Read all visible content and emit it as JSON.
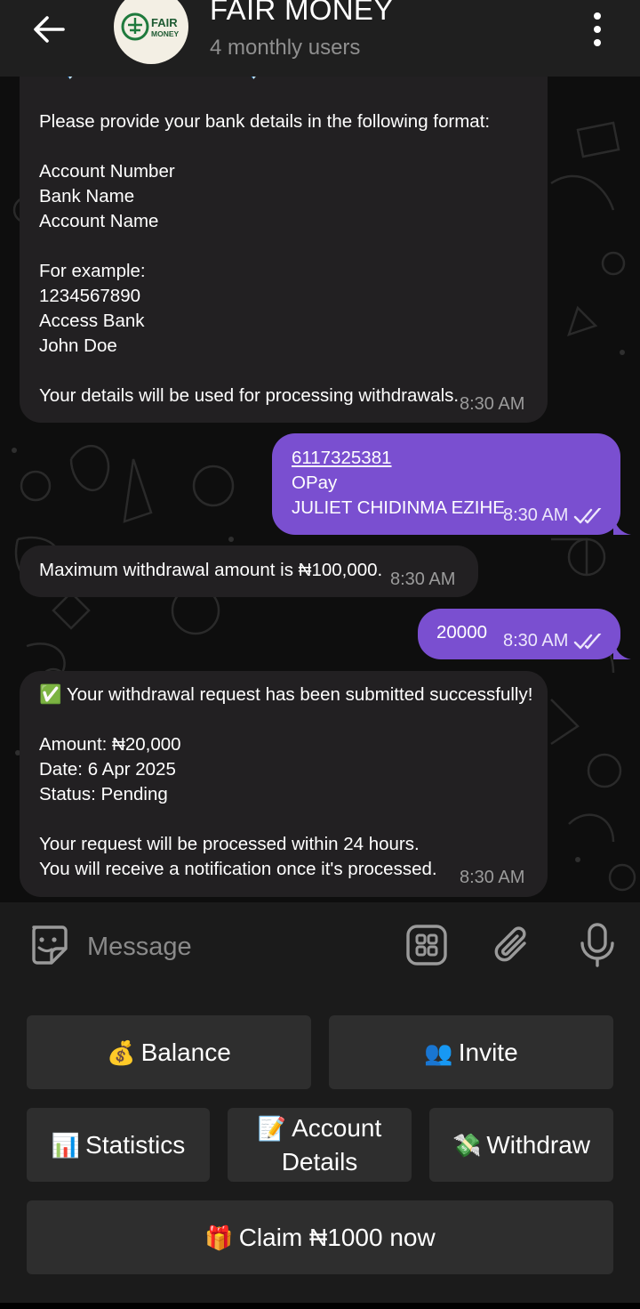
{
  "header": {
    "title": "FAIR MONEY",
    "subtitle": "4 monthly users",
    "logo_text_1": "FAIR",
    "logo_text_2": "MONEY"
  },
  "messages": [
    {
      "direction": "incoming",
      "partial_heading": "💎 Enter Bank Details 💎",
      "text": "Please provide your bank details in the following format:\n\nAccount Number\nBank Name\nAccount Name\n\nFor example:\n1234567890\nAccess Bank\nJohn Doe\n\nYour details will be used for processing withdrawals.",
      "time": "8:30 AM"
    },
    {
      "direction": "outgoing",
      "account_number": "6117325381",
      "text": "OPay\nJULIET CHIDINMA EZIHE",
      "time": "8:30 AM",
      "status": "read"
    },
    {
      "direction": "incoming",
      "text": "Maximum withdrawal amount is ₦100,000.",
      "time": "8:30 AM"
    },
    {
      "direction": "outgoing",
      "text": "20000",
      "time": "8:30 AM",
      "status": "read"
    },
    {
      "direction": "incoming",
      "text": "✅ Your withdrawal request has been submitted successfully!\n\nAmount: ₦20,000\nDate: 6 Apr 2025\nStatus: Pending\n\nYour request will be processed within 24 hours.\nYou will receive a notification once it's processed.",
      "time": "8:30 AM"
    }
  ],
  "input": {
    "placeholder": "Message"
  },
  "keyboard": {
    "balance": {
      "emoji": "💰",
      "label": "Balance"
    },
    "invite": {
      "emoji": "👥",
      "label": "Invite"
    },
    "statistics": {
      "emoji": "📊",
      "label": "Statistics"
    },
    "account_details": {
      "emoji": "📝",
      "label_1": "Account",
      "label_2": "Details"
    },
    "withdraw": {
      "emoji": "💸",
      "label": "Withdraw"
    },
    "claim": {
      "emoji": "🎁",
      "label": "Claim ₦1000 now"
    }
  },
  "colors": {
    "outgoing_bubble": "#7a4fd0",
    "incoming_bubble": "#222022",
    "header_bg": "#1f1f1f",
    "keyboard_button": "#2e2e2e"
  }
}
